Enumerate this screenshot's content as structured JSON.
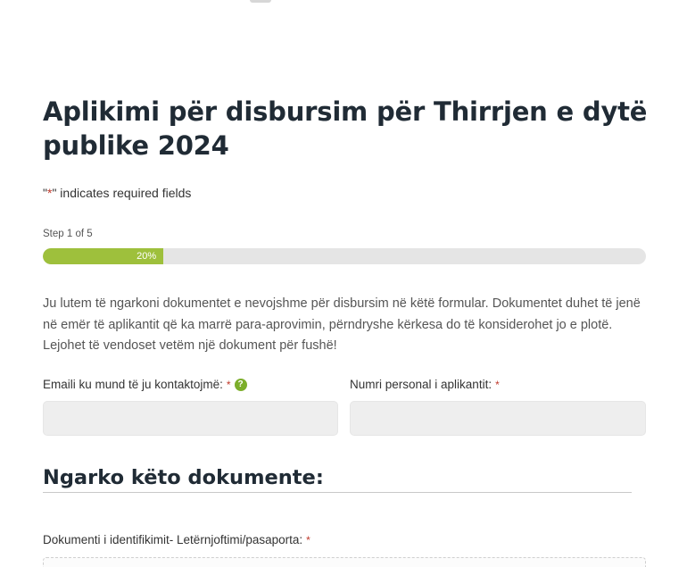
{
  "form": {
    "title": "Aplikimi për disbursim për Thirrjen e dytë publike 2024",
    "required_note_prefix": "\"",
    "required_note_asterisk": "*",
    "required_note_suffix": "\" indicates required fields",
    "step_label": "Step 1 of 5",
    "progress_percent": 20,
    "progress_label": "20%",
    "intro": "Ju lutem të ngarkoni dokumentet e nevojshme për disbursim në këtë formular. Dokumentet duhet të jenë në emër të aplikantit që ka marrë para-aprovimin, përndryshe kërkesa do të konsiderohet jo e plotë. Lejohet të vendoset vetëm një dokument për fushë!"
  },
  "fields": {
    "email": {
      "label": "Emaili ku mund të ju kontaktojmë:",
      "required_mark": "*",
      "help_icon": "question-circle-icon",
      "value": ""
    },
    "personal_number": {
      "label": "Numri personal i aplikantit:",
      "required_mark": "*",
      "value": ""
    }
  },
  "section": {
    "title": "Ngarko këto dokumente:"
  },
  "upload": {
    "id_document": {
      "label": "Dokumenti i identifikimit- Letërnjoftimi/pasaporta:",
      "required_mark": "*"
    }
  },
  "colors": {
    "accent_green": "#9ec03c",
    "required_red": "#c0392b",
    "input_bg": "#eeeeee"
  }
}
